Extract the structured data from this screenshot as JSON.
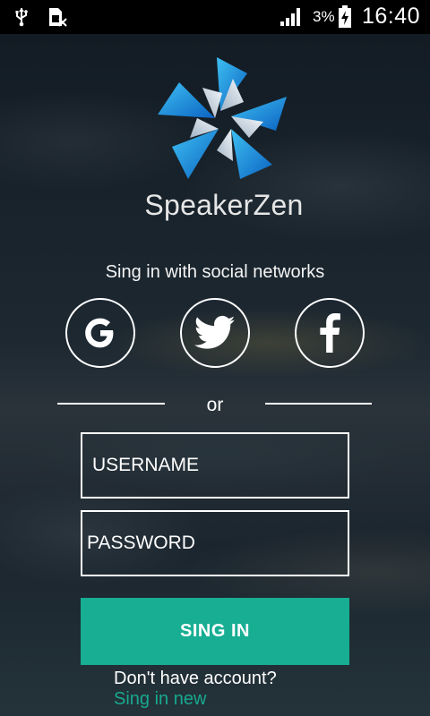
{
  "status_bar": {
    "battery_percent": "3%",
    "time": "16:40",
    "icons": [
      "usb-icon",
      "sim-card-icon",
      "signal-icon",
      "battery-charging-icon"
    ]
  },
  "brand": {
    "name": "SpeakerZen",
    "logo_icon": "pinwheel-logo-icon",
    "colors": {
      "logo_blue": "#1ea3e6",
      "logo_dark_blue": "#0c67c4"
    }
  },
  "social": {
    "heading": "Sing in with social networks",
    "buttons": [
      {
        "name": "Google",
        "icon": "google-icon"
      },
      {
        "name": "Twitter",
        "icon": "twitter-icon"
      },
      {
        "name": "Facebook",
        "icon": "facebook-icon"
      }
    ]
  },
  "separator_text": "or",
  "form": {
    "username_placeholder": "USERNAME",
    "username_value": "",
    "password_placeholder": "PASSWORD",
    "password_value": "",
    "submit_label": "SING IN",
    "submit_color": "#17ae93"
  },
  "footer": {
    "prompt": "Don't have account?",
    "link_label": "Sing in new",
    "link_color": "#18a98f"
  }
}
